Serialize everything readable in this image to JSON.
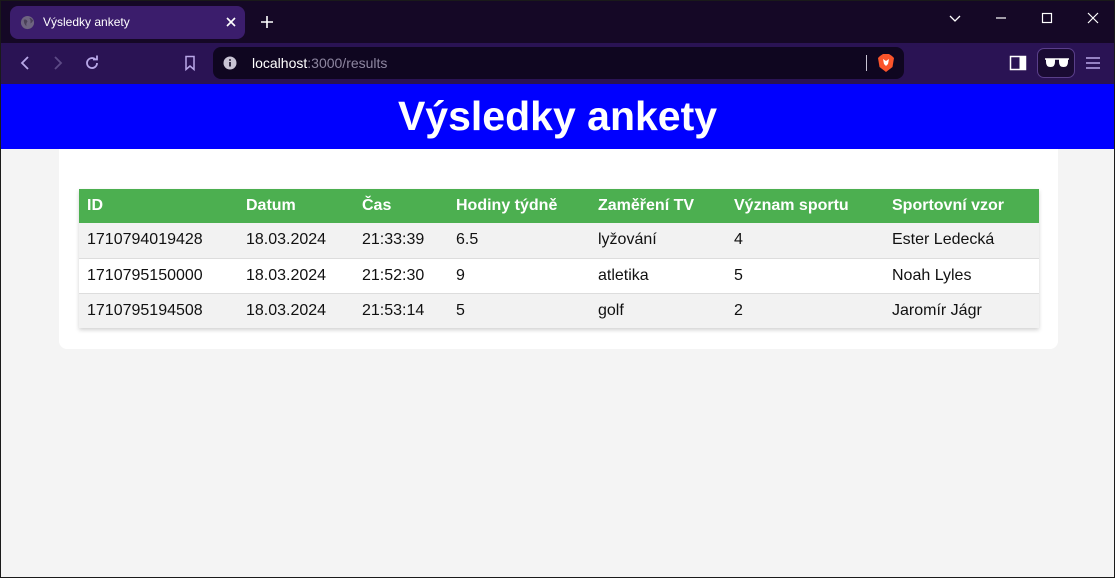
{
  "browser": {
    "tab_title": "Výsledky ankety",
    "url_host": "localhost",
    "url_path": ":3000/results"
  },
  "page": {
    "title": "Výsledky ankety"
  },
  "table": {
    "headers": [
      "ID",
      "Datum",
      "Čas",
      "Hodiny týdně",
      "Zaměření TV",
      "Význam sportu",
      "Sportovní vzor"
    ],
    "rows": [
      [
        "1710794019428",
        "18.03.2024",
        "21:33:39",
        "6.5",
        "lyžování",
        "4",
        "Ester Ledecká"
      ],
      [
        "1710795150000",
        "18.03.2024",
        "21:52:30",
        "9",
        "atletika",
        "5",
        "Noah Lyles"
      ],
      [
        "1710795194508",
        "18.03.2024",
        "21:53:14",
        "5",
        "golf",
        "2",
        "Jaromír Jágr"
      ]
    ]
  },
  "colors": {
    "header_bg": "#0000ff",
    "table_header_bg": "#4caf50",
    "chrome_bg": "#150826",
    "toolbar_bg": "#2a1354"
  }
}
